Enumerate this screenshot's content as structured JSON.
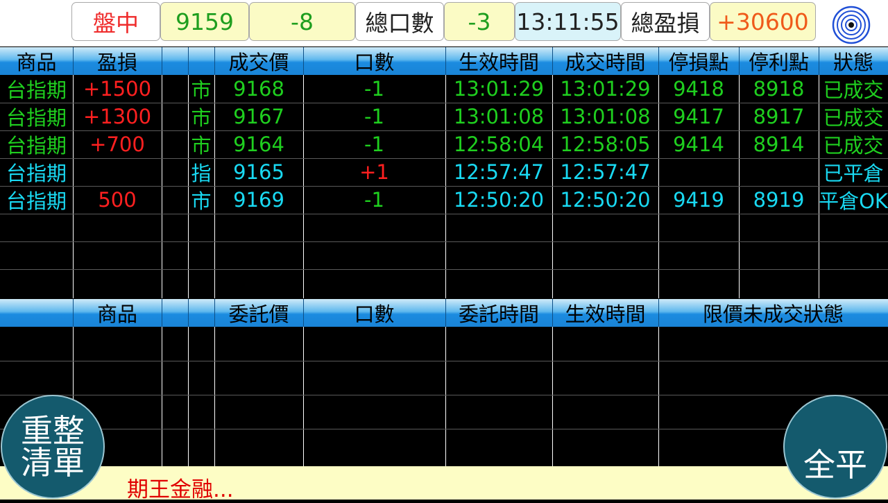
{
  "topbar": {
    "status": "盤中",
    "price": "9159",
    "change": "-8",
    "total_qty_label": "總口數",
    "total_qty": "-3",
    "time": "13:11:55",
    "total_pnl_label": "總盈損",
    "total_pnl": "+30600",
    "icon": "target-icon"
  },
  "trades": {
    "headers": [
      "商品",
      "盈損",
      "",
      "",
      "成交價",
      "口數",
      "生效時間",
      "成交時間",
      "停損點",
      "停利點",
      "狀態"
    ],
    "rows": [
      {
        "product": "台指期",
        "pnl": "+1500",
        "type": "市",
        "price": "9168",
        "qty": "-1",
        "eff_time": "13:01:29",
        "fill_time": "13:01:29",
        "stop_loss": "9418",
        "take_profit": "8918",
        "status": "已成交"
      },
      {
        "product": "台指期",
        "pnl": "+1300",
        "type": "市",
        "price": "9167",
        "qty": "-1",
        "eff_time": "13:01:08",
        "fill_time": "13:01:08",
        "stop_loss": "9417",
        "take_profit": "8917",
        "status": "已成交"
      },
      {
        "product": "台指期",
        "pnl": "+700",
        "type": "市",
        "price": "9164",
        "qty": "-1",
        "eff_time": "12:58:04",
        "fill_time": "12:58:05",
        "stop_loss": "9414",
        "take_profit": "8914",
        "status": "已成交"
      },
      {
        "product": "台指期",
        "pnl": "",
        "type": "指",
        "price": "9165",
        "qty": "+1",
        "eff_time": "12:57:47",
        "fill_time": "12:57:47",
        "stop_loss": "",
        "take_profit": "",
        "status": "已平倉"
      },
      {
        "product": "台指期",
        "pnl": "500",
        "type": "市",
        "price": "9169",
        "qty": "-1",
        "eff_time": "12:50:20",
        "fill_time": "12:50:20",
        "stop_loss": "9419",
        "take_profit": "8919",
        "status": "平倉OK"
      }
    ]
  },
  "orders": {
    "headers": [
      "",
      "商品",
      "",
      "",
      "委託價",
      "口數",
      "委託時間",
      "生效時間",
      "限價未成交狀態"
    ]
  },
  "buttons": {
    "reset_line1": "重整",
    "reset_line2": "清單",
    "close_all": "全平"
  },
  "footer": {
    "text": "期王金融..."
  },
  "colors": {
    "green": "#1fcf1f",
    "cyan": "#19d9f2",
    "red": "#ff2020",
    "header_blue": "#1b8be0",
    "footer_yellow": "#fdfdc5"
  }
}
